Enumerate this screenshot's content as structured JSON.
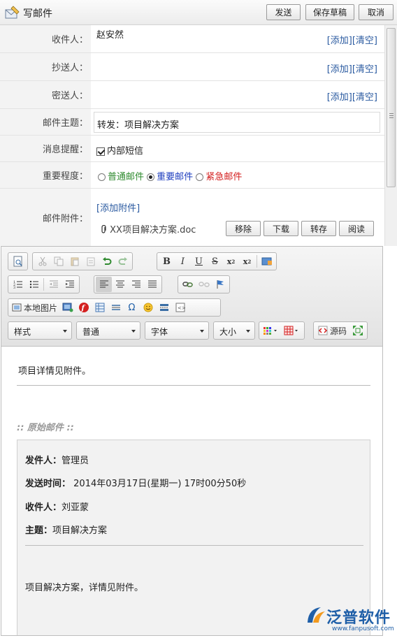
{
  "window": {
    "title": "写邮件",
    "buttons": {
      "send": "发送",
      "save_draft": "保存草稿",
      "cancel": "取消"
    }
  },
  "form": {
    "to": {
      "label": "收件人：",
      "value": "赵安然",
      "add": "[添加]",
      "clear": "[清空]"
    },
    "cc": {
      "label": "抄送人：",
      "value": "",
      "add": "[添加]",
      "clear": "[清空]"
    },
    "bcc": {
      "label": "密送人：",
      "value": "",
      "add": "[添加]",
      "clear": "[清空]"
    },
    "subject": {
      "label": "邮件主题：",
      "value": "转发：项目解决方案"
    },
    "notify": {
      "label": "消息提醒：",
      "option": "内部短信",
      "checked": true
    },
    "priority": {
      "label": "重要程度：",
      "options": [
        {
          "label": "普通邮件",
          "color": "#2e8b2e",
          "selected": false
        },
        {
          "label": "重要邮件",
          "color": "#1f3fbf",
          "selected": true
        },
        {
          "label": "紧急邮件",
          "color": "#d42020",
          "selected": false
        }
      ]
    },
    "attachments": {
      "label": "邮件附件：",
      "add_link": "[添加附件]",
      "file": "XX项目解决方案.doc",
      "actions": {
        "remove": "移除",
        "download": "下载",
        "save": "转存",
        "read": "阅读"
      }
    }
  },
  "editor": {
    "toolbar": {
      "local_image": "本地图片",
      "style": "样式",
      "format": "普通",
      "font": "字体",
      "size": "大小",
      "source": "源码"
    },
    "body_text": "项目详情见附件。",
    "original_heading": ":: 原始邮件 ::",
    "original": {
      "from_label": "发件人：",
      "from": "管理员",
      "time_label": "发送时间：",
      "time": "2014年03月17日(星期一) 17时00分50秒",
      "to_label": "收件人：",
      "to": "刘亚蒙",
      "subject_label": "主题：",
      "subject": "项目解决方案",
      "body": "项目解决方案，详情见附件。"
    }
  },
  "watermark": {
    "brand": "泛普软件",
    "url": "www.fanpusoft.com",
    "color": "#1f5fa8"
  }
}
